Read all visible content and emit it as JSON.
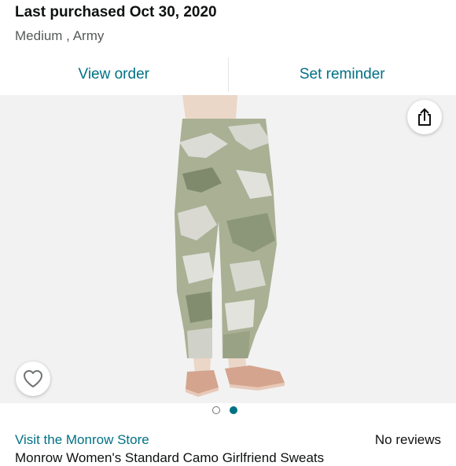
{
  "purchase": {
    "title": "Last purchased Oct 30, 2020",
    "variant": "Medium , Army"
  },
  "actions": {
    "view_order": "View order",
    "set_reminder": "Set reminder"
  },
  "gallery": {
    "share_icon": "share-icon",
    "wishlist_icon": "heart-icon",
    "dots_total": 2,
    "active_dot": 2
  },
  "store": {
    "link": "Visit the Monrow Store"
  },
  "reviews": {
    "text": "No reviews"
  },
  "product": {
    "title_partial": "Monrow Women's Standard Camo Girlfriend Sweats"
  },
  "colors": {
    "link": "#007185",
    "text": "#0f1111",
    "secondary": "#565959",
    "gallery_bg": "#f2f2f2"
  }
}
